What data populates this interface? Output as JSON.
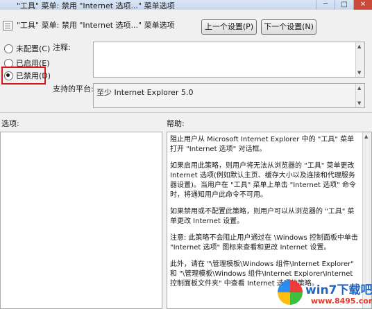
{
  "window": {
    "title": "\"工具\" 菜单: 禁用 \"Internet 选项...\" 菜单选项",
    "minimize": "─",
    "maximize": "□",
    "close": "✕"
  },
  "policy": {
    "title": "\"工具\" 菜单: 禁用 \"Internet 选项...\" 菜单选项",
    "prev_button": "上一个设置(P)",
    "next_button": "下一个设置(N)"
  },
  "state_options": [
    {
      "label": "未配置(C)",
      "checked": false
    },
    {
      "label": "已启用(E)",
      "checked": false
    },
    {
      "label": "已禁用(D)",
      "checked": true
    }
  ],
  "comment": {
    "label": "注释:",
    "value": ""
  },
  "platform": {
    "label": "支持的平台:",
    "value": "至少 Internet Explorer 5.0"
  },
  "options": {
    "label": "选项:"
  },
  "help": {
    "label": "帮助:",
    "paragraphs": [
      "阻止用户从 Microsoft Internet Explorer 中的 \"工具\" 菜单打开 \"Internet 选项\" 对话框。",
      "如果启用此策略，则用户将无法从浏览器的 \"工具\" 菜单更改 Internet 选项(例如默认主页、缓存大小以及连接和代理服务器设置)。当用户在 \"工具\" 菜单上单击 \"Internet 选项\" 命令时，将通知用户此命令不可用。",
      "如果禁用或不配置此策略，则用户可以从浏览器的 \"工具\" 菜单更改 Internet 设置。",
      "注意: 此策略不会阻止用户通过在 \\Windows 控制面板中单击 \"Internet 选项\" 图标来查看和更改 Internet 设置。",
      "此外，请在 \"\\管理模板\\Windows 组件\\Internet Explorer\" 和 \"\\管理模板\\Windows 组件\\Internet Explorer\\Internet 控制面板文件夹\" 中查看 Internet 选项的策略。"
    ]
  },
  "watermark": {
    "brand": "win7下载吧",
    "url": "www.8495.com"
  }
}
